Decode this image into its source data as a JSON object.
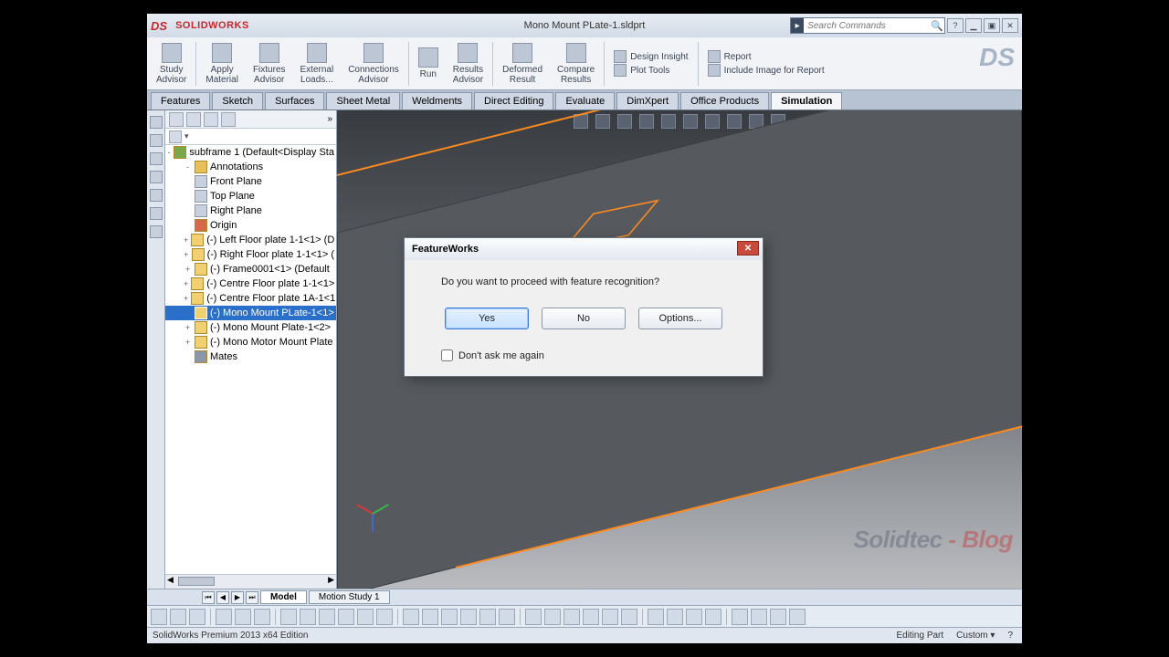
{
  "title": {
    "brand": "SOLIDWORKS",
    "document": "Mono Mount PLate-1.sldprt",
    "search_placeholder": "Search Commands"
  },
  "ribbon": {
    "study_advisor": "Study\nAdvisor",
    "apply_material": "Apply\nMaterial",
    "fixtures_advisor": "Fixtures\nAdvisor",
    "external_loads": "External\nLoads...",
    "connections_advisor": "Connections\nAdvisor",
    "run": "Run",
    "results_advisor": "Results\nAdvisor",
    "deformed_result": "Deformed\nResult",
    "compare_results": "Compare\nResults",
    "design_insight": "Design Insight",
    "plot_tools": "Plot Tools",
    "report": "Report",
    "include_image": "Include Image for Report"
  },
  "tabs": [
    "Features",
    "Sketch",
    "Surfaces",
    "Sheet Metal",
    "Weldments",
    "Direct Editing",
    "Evaluate",
    "DimXpert",
    "Office Products",
    "Simulation"
  ],
  "active_tab": "Simulation",
  "tree": {
    "root": "subframe 1  (Default<Display Sta",
    "items": [
      {
        "label": "Annotations",
        "icon": "ann",
        "indent": 1,
        "exp": "-"
      },
      {
        "label": "Front Plane",
        "icon": "plane",
        "indent": 1
      },
      {
        "label": "Top Plane",
        "icon": "plane",
        "indent": 1
      },
      {
        "label": "Right Plane",
        "icon": "plane",
        "indent": 1
      },
      {
        "label": "Origin",
        "icon": "origin",
        "indent": 1
      },
      {
        "label": "(-) Left Floor plate 1-1<1>  (D",
        "icon": "part",
        "indent": 1,
        "exp": "+"
      },
      {
        "label": "(-) Right Floor plate 1-1<1>  (",
        "icon": "part",
        "indent": 1,
        "exp": "+"
      },
      {
        "label": "(-) Frame0001<1> (Default",
        "icon": "part",
        "indent": 1,
        "exp": "+"
      },
      {
        "label": "(-) Centre Floor plate 1-1<1>",
        "icon": "part",
        "indent": 1,
        "exp": "+"
      },
      {
        "label": "(-) Centre Floor plate 1A-1<1",
        "icon": "part",
        "indent": 1,
        "exp": "+"
      },
      {
        "label": "(-) Mono Mount PLate-1<1>",
        "icon": "part",
        "indent": 1,
        "exp": "+",
        "selected": true
      },
      {
        "label": "(-) Mono Mount Plate-1<2>",
        "icon": "part",
        "indent": 1,
        "exp": "+"
      },
      {
        "label": "(-) Mono Motor Mount Plate",
        "icon": "part",
        "indent": 1,
        "exp": "+"
      },
      {
        "label": "Mates",
        "icon": "mates",
        "indent": 1
      }
    ]
  },
  "dialog": {
    "title": "FeatureWorks",
    "message": "Do you want to proceed with feature recognition?",
    "yes": "Yes",
    "no": "No",
    "options": "Options...",
    "dont_ask": "Don't ask me again"
  },
  "bottom_tabs": {
    "model": "Model",
    "motion": "Motion Study 1"
  },
  "status": {
    "left": "SolidWorks Premium 2013 x64 Edition",
    "editing": "Editing Part",
    "custom": "Custom"
  },
  "watermark": {
    "a": "Solidtec",
    "b": " - Blog"
  },
  "palette_colors": [
    "#6aa8e8",
    "#4aa3d4",
    "#e8c05a",
    "#7aa84a",
    "#d0b060",
    "#c0c8d4",
    "#d46a4a",
    "#e6d060",
    "#7a8494",
    "#c7d0dc"
  ]
}
